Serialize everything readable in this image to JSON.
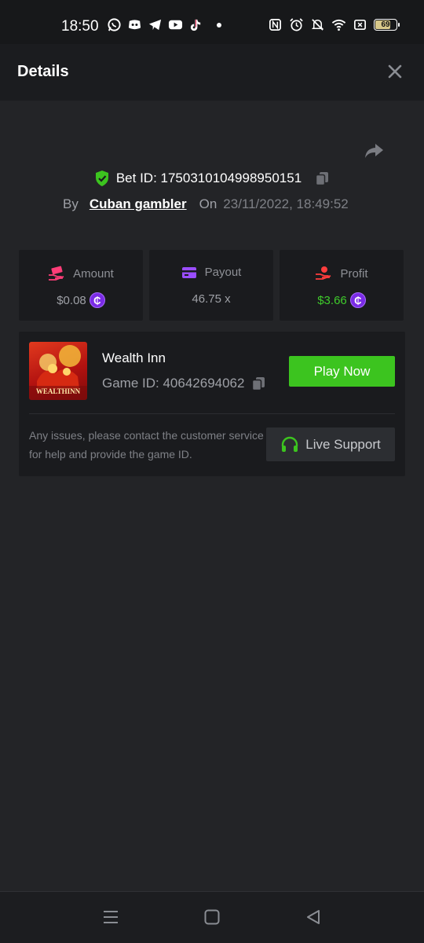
{
  "status_bar": {
    "time": "18:50",
    "battery": "69",
    "left_icons": [
      "whatsapp-icon",
      "discord-icon",
      "telegram-icon",
      "youtube-icon",
      "tiktok-icon"
    ],
    "right_icons": [
      "nfc-icon",
      "alarm-icon",
      "mute-icon",
      "wifi-icon",
      "close-box-icon"
    ]
  },
  "header": {
    "title": "Details"
  },
  "bet": {
    "id_label": "Bet ID: 1750310104998950151",
    "by_label": "By",
    "user": "Cuban gambler",
    "on_label": "On",
    "date": "23/11/2022, 18:49:52"
  },
  "stats": [
    {
      "label": "Amount",
      "value": "$0.08",
      "coin": "₵",
      "icon": "money-hand-icon"
    },
    {
      "label": "Payout",
      "value": "46.75 x",
      "icon": "card-icon"
    },
    {
      "label": "Profit",
      "value": "$3.66",
      "coin": "₵",
      "icon": "profit-hand-icon"
    }
  ],
  "game": {
    "name": "Wealth Inn",
    "id_label": "Game ID: 40642694062",
    "play_label": "Play Now",
    "thumb_text": "WEALTHINN",
    "notice": "Any issues, please contact the customer service for help and provide the game ID.",
    "support_label": "Live Support"
  },
  "colors": {
    "accent_green": "#3cc41f",
    "profit_green": "#3fcb2b",
    "coin_purple": "#7a2be6",
    "background": "#232427",
    "card": "#1a1b1e"
  }
}
